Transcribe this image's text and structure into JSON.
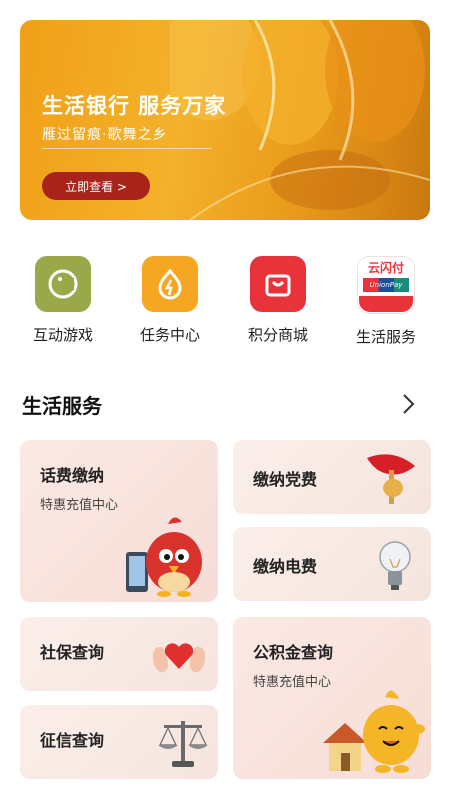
{
  "banner": {
    "title": "生活银行 服务万家",
    "subtitle": "雁过留痕·歌舞之乡",
    "button_label": "立即查看 >"
  },
  "quick_actions": [
    {
      "label": "互动游戏",
      "icon": "game-icon",
      "color": "#9aa84a"
    },
    {
      "label": "任务中心",
      "icon": "task-icon",
      "color": "#f5a623"
    },
    {
      "label": "积分商城",
      "icon": "shopping-bag-icon",
      "color": "#e8333a"
    },
    {
      "label": "生活服务",
      "icon": "unionpay-icon",
      "color": "#e8333a"
    }
  ],
  "unionpay_logo": {
    "brand_cn": "云闪付",
    "brand_en": "UnionPay"
  },
  "section": {
    "title": "生活服务"
  },
  "services": {
    "phone_bill": {
      "title": "话费缴纳",
      "subtitle": "特惠充值中心"
    },
    "party_fee": {
      "title": "缴纳党费"
    },
    "electricity": {
      "title": "缴纳电费"
    },
    "social_security": {
      "title": "社保查询"
    },
    "housing_fund": {
      "title": "公积金查询",
      "subtitle": "特惠充值中心"
    },
    "credit": {
      "title": "征信查询"
    }
  }
}
